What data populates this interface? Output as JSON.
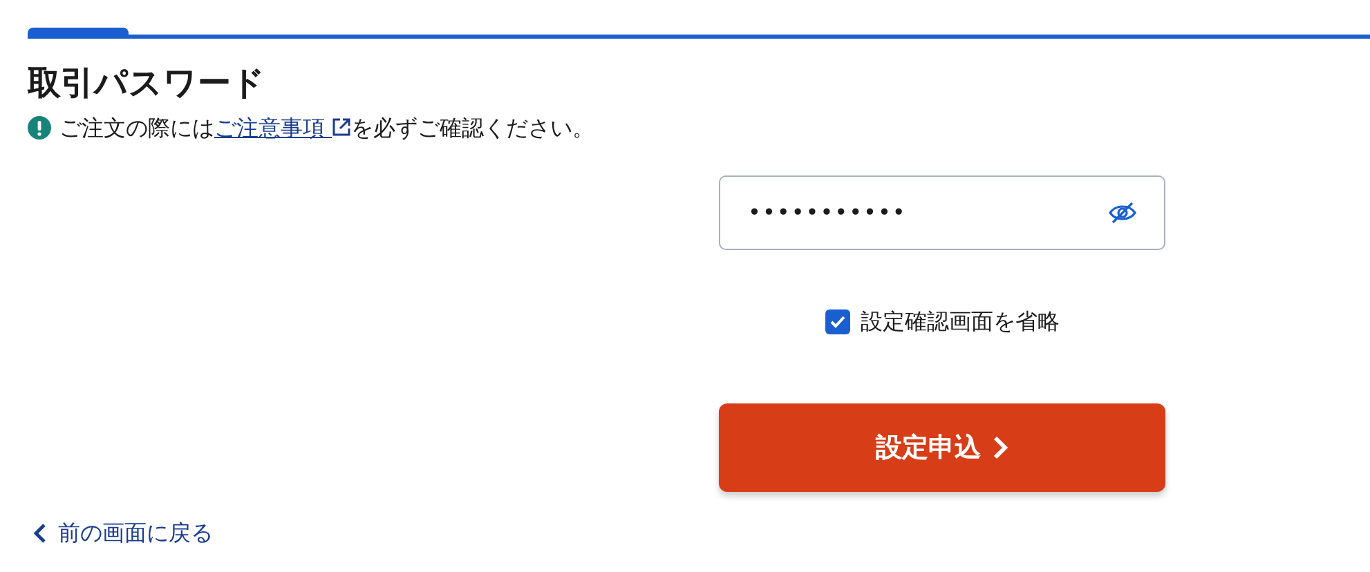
{
  "title": "取引パスワード",
  "notice": {
    "before": "ご注文の際には",
    "link": "ご注意事項",
    "after": "を必ずご確認ください。"
  },
  "password": {
    "value": "•••••••••••",
    "visible": false
  },
  "skip_confirm": {
    "label": "設定確認画面を省略",
    "checked": true
  },
  "submit": {
    "label": "設定申込"
  },
  "back": {
    "label": "前の画面に戻る"
  }
}
